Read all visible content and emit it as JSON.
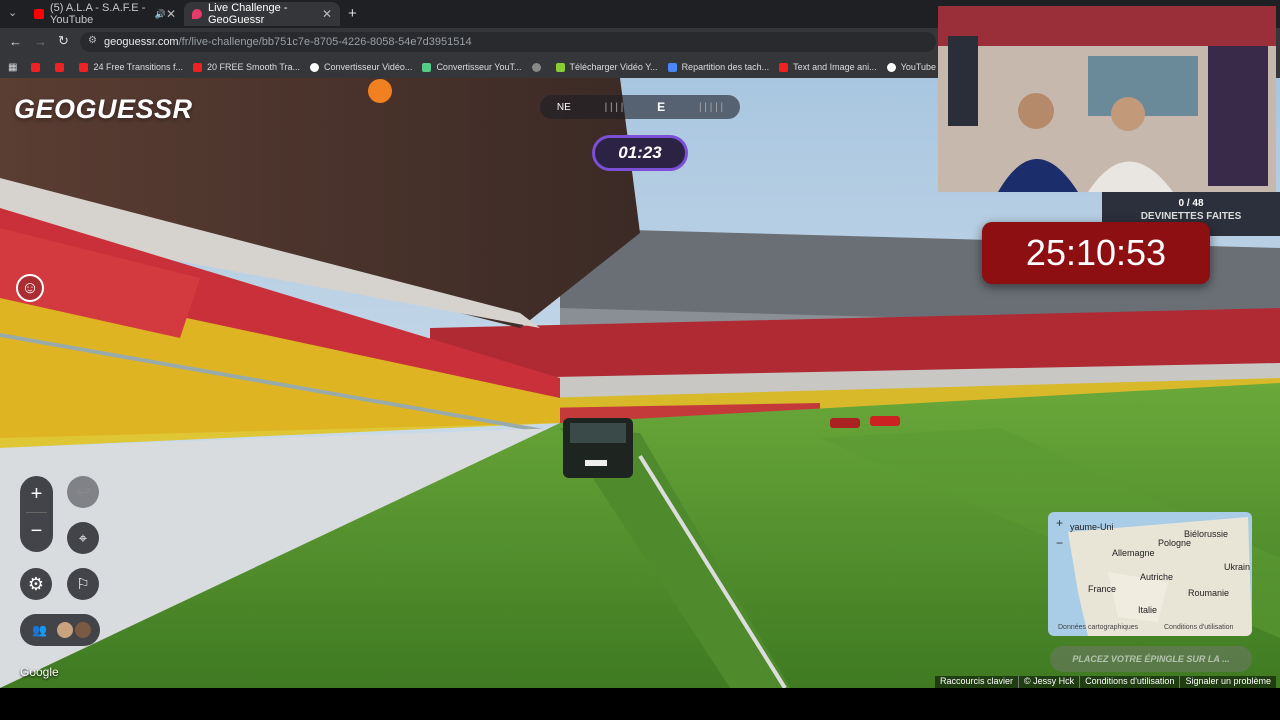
{
  "tabs": [
    {
      "label": "(5) A.L.A - S.A.F.E - YouTube",
      "favicon_color": "#ff0000"
    },
    {
      "label": "Live Challenge - GeoGuessr",
      "favicon_color": "#e63a6b"
    }
  ],
  "new_tab": "+",
  "url": {
    "domain": "geoguessr.com",
    "path": "/fr/live-challenge/bb751c7e-8705-4226-8058-54e7d3951514"
  },
  "bookmarks": [
    "24 Free Transitions f...",
    "20 FREE Smooth Tra...",
    "Convertisseur Vidéo...",
    "Convertisseur YouT...",
    "Télécharger Vidéo Y...",
    "Repartition des tach...",
    "Text and Image ani...",
    "YouTube Converter..."
  ],
  "game": {
    "logo": "GEOGUESSR",
    "compass": {
      "left": "NE",
      "right": "E"
    },
    "round_timer": "01:23",
    "guesses_count": "0 / 48",
    "guesses_label": "DEVINETTES FAITES",
    "big_timer": "25:10:53",
    "zoom_in": "+",
    "zoom_out": "−",
    "undo": "↩",
    "map_labels": [
      "yaume-Uni",
      "Biélorussie",
      "Pologne",
      "Allemagne",
      "Ukrain",
      "France",
      "Autriche",
      "Roumanie",
      "Italie"
    ],
    "map_attribution": [
      "Données cartographiques",
      "Conditions d'utilisation"
    ],
    "place_pin": "PLACEZ VOTRE ÉPINGLE SUR LA ...",
    "google_watermark": "Google"
  },
  "footer_links": [
    "Raccourcis clavier",
    "© Jessy Hck",
    "Conditions d'utilisation",
    "Signaler un problème"
  ],
  "colors": {
    "timer_border": "#7b4fd6",
    "big_timer_bg": "#8e0f12",
    "chrome_bg": "#35363a"
  }
}
